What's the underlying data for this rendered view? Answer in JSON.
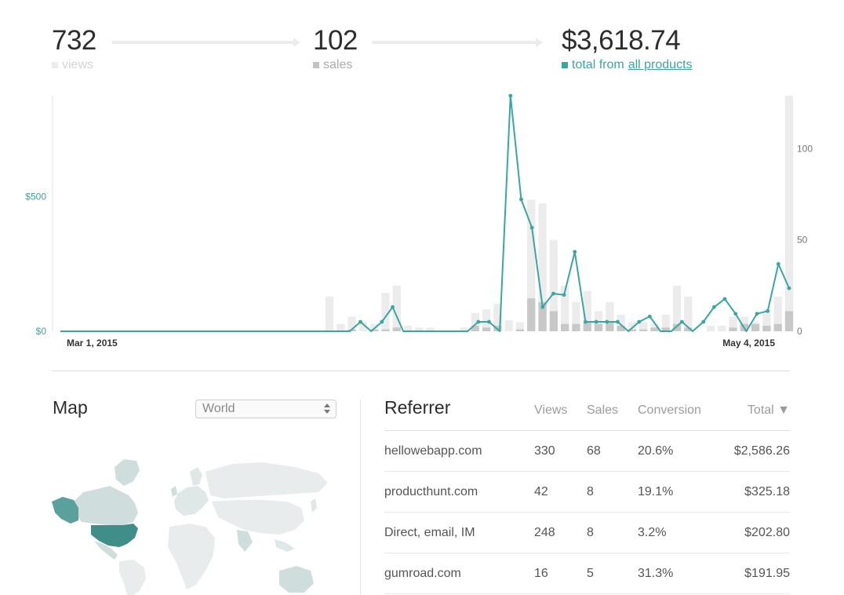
{
  "stats": {
    "views": {
      "value": "732",
      "label": "views"
    },
    "sales": {
      "value": "102",
      "label": "sales"
    },
    "total": {
      "value": "$3,618.74",
      "label": "total from",
      "link": "all products"
    }
  },
  "chart_data": {
    "type": "bar+line",
    "x_start_label": "Mar 1, 2015",
    "x_end_label": "May 4, 2015",
    "days": 65,
    "left_axis": {
      "ticks": [
        "$0",
        "$500"
      ],
      "tick_values": [
        0,
        500
      ],
      "range": [
        0,
        875
      ],
      "color": "#3aa6a4"
    },
    "right_axis": {
      "ticks": [
        "0",
        "50",
        "100"
      ],
      "tick_values": [
        0,
        50,
        100
      ],
      "range": [
        0,
        129
      ]
    },
    "series": [
      {
        "name": "views",
        "kind": "bar",
        "color": "#ececec",
        "values": [
          0,
          0,
          0,
          0,
          0,
          0,
          0,
          0,
          0,
          0,
          0,
          0,
          0,
          0,
          0,
          0,
          0,
          0,
          0,
          0,
          0,
          0,
          0,
          0,
          19,
          4,
          8,
          5,
          4,
          21,
          25,
          3,
          2,
          2,
          0,
          0,
          2,
          10,
          12,
          15,
          6,
          5,
          72,
          70,
          50,
          25,
          16,
          22,
          11,
          16,
          9,
          5,
          5,
          4,
          9,
          25,
          19,
          0,
          3,
          3,
          8,
          8,
          5,
          12,
          19,
          129
        ]
      },
      {
        "name": "sales",
        "kind": "bar",
        "color": "#c8c8c8",
        "values": [
          0,
          0,
          0,
          0,
          0,
          0,
          0,
          0,
          0,
          0,
          0,
          0,
          0,
          0,
          0,
          0,
          0,
          0,
          0,
          0,
          0,
          0,
          0,
          0,
          0,
          0,
          1,
          0,
          1,
          1,
          2,
          0,
          0,
          0,
          0,
          0,
          0,
          3,
          2,
          3,
          0,
          1,
          18,
          16,
          11,
          4,
          4,
          5,
          4,
          5,
          3,
          1,
          1,
          2,
          2,
          4,
          2,
          0,
          0,
          0,
          2,
          4,
          4,
          3,
          4,
          11
        ]
      },
      {
        "name": "revenue",
        "kind": "line",
        "color": "#3aa6a4",
        "values": [
          0,
          0,
          0,
          0,
          0,
          0,
          0,
          0,
          0,
          0,
          0,
          0,
          0,
          0,
          0,
          0,
          0,
          0,
          0,
          0,
          0,
          0,
          0,
          0,
          0,
          0,
          0,
          0,
          35,
          0,
          35,
          90,
          0,
          0,
          0,
          0,
          0,
          0,
          0,
          35,
          35,
          0,
          875,
          490,
          385,
          90,
          140,
          135,
          295,
          35,
          35,
          35,
          35,
          0,
          35,
          55,
          0,
          0,
          35,
          0,
          35,
          90,
          120,
          65,
          0,
          65,
          75,
          250,
          160
        ]
      }
    ]
  },
  "map": {
    "title": "Map",
    "region_select": {
      "selected": "World"
    }
  },
  "referrers": {
    "title": "Referrer",
    "columns": {
      "views": "Views",
      "sales": "Sales",
      "conversion": "Conversion",
      "total": "Total ▼"
    },
    "rows": [
      {
        "name": "hellowebapp.com",
        "views": "330",
        "sales": "68",
        "conversion": "20.6%",
        "total": "$2,586.26"
      },
      {
        "name": "producthunt.com",
        "views": "42",
        "sales": "8",
        "conversion": "19.1%",
        "total": "$325.18"
      },
      {
        "name": "Direct, email, IM",
        "views": "248",
        "sales": "8",
        "conversion": "3.2%",
        "total": "$202.80"
      },
      {
        "name": "gumroad.com",
        "views": "16",
        "sales": "5",
        "conversion": "31.3%",
        "total": "$191.95"
      }
    ]
  },
  "colors": {
    "accent": "#3aa6a4",
    "views_bar": "#ececec",
    "sales_bar": "#c8c8c8",
    "map_land": "#e8ecec",
    "map_low": "#cfdedd",
    "map_mid": "#a5c9c7",
    "map_high": "#5aa09d"
  },
  "icons": {
    "views_swatch": "square-swatch-icon",
    "sales_swatch": "square-swatch-icon",
    "total_swatch": "square-swatch-icon",
    "flow_arrow": "right-arrow-icon",
    "select_arrows": "updown-arrows-icon",
    "sort": "down-triangle-icon"
  }
}
